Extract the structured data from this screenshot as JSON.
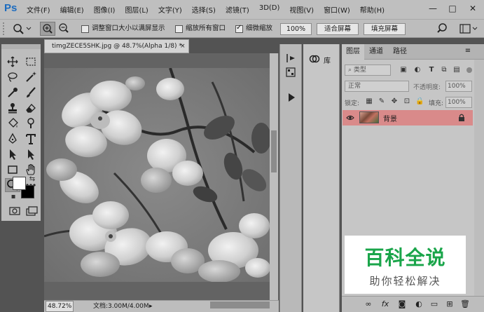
{
  "app": {
    "logo": "Ps"
  },
  "menu": [
    "文件(F)",
    "编辑(E)",
    "图像(I)",
    "图层(L)",
    "文字(Y)",
    "选择(S)",
    "滤镜(T)",
    "3D(D)",
    "视图(V)",
    "窗口(W)",
    "帮助(H)"
  ],
  "window_controls": {
    "minimize": "—",
    "restore": "□",
    "close": "✕"
  },
  "options": {
    "resize_windows_label": "调整窗口大小以满屏显示",
    "zoom_all_label": "缩放所有窗口",
    "scrubby_label": "细微缩放",
    "zoom_value": "100%",
    "fit_screen": "适合屏幕",
    "fill_screen": "填充屏幕"
  },
  "document": {
    "tab_title": "timgZECE5SHK.jpg @ 48.7%(Alpha 1/8) *",
    "close": "×",
    "zoom": "48.72%",
    "doc_info": "文档:3.00M/4.00M"
  },
  "library": {
    "label": "库"
  },
  "layers_panel": {
    "tabs": [
      "图层",
      "通道",
      "路径"
    ],
    "filter_kind": "类型",
    "blend_mode": "正常",
    "opacity_label": "不透明度:",
    "opacity_value": "100%",
    "lock_label": "锁定:",
    "fill_label": "填充:",
    "fill_value": "100%",
    "layers": [
      {
        "name": "背景",
        "locked": true
      }
    ]
  },
  "watermark": {
    "title": "百科全说",
    "subtitle": "助你轻松解决"
  },
  "colors": {
    "accent": "#1d6cbf",
    "layer_highlight": "#d98a8a",
    "watermark_green": "#1aa54a"
  }
}
